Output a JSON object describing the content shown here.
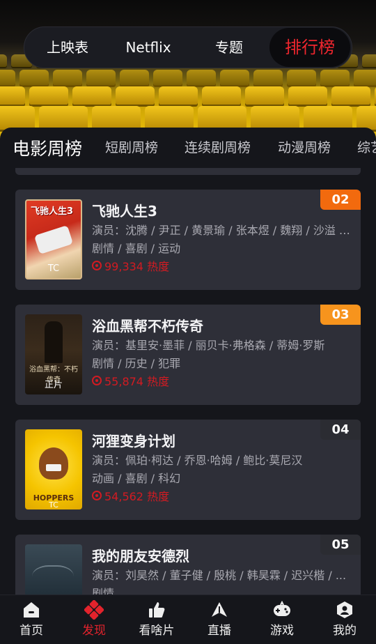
{
  "top_nav": {
    "tabs": [
      {
        "label": "上映表"
      },
      {
        "label": "Netflix"
      },
      {
        "label": "专题"
      },
      {
        "label": "排行榜",
        "active": true
      }
    ]
  },
  "category_tabs": [
    {
      "label": "电影周榜",
      "active": true
    },
    {
      "label": "短剧周榜"
    },
    {
      "label": "连续剧周榜"
    },
    {
      "label": "动漫周榜"
    },
    {
      "label": "综艺"
    }
  ],
  "ranking": [
    {
      "rank": "02",
      "rank_color": "#f26a0e",
      "title": "飞驰人生3",
      "actors": "演员：沈腾 / 尹正 / 黄景瑜 / 张本煜 / 魏翔 / 沙溢 / ...",
      "genres": "剧情 / 喜剧 / 运动",
      "heat": "99,334 热度",
      "poster_tag": "TC",
      "poster_title": "飞驰人生3"
    },
    {
      "rank": "03",
      "rank_color": "#f7941d",
      "title": "浴血黑帮不朽传奇",
      "actors": "演员：基里安·墨菲 / 丽贝卡·弗格森 / 蒂姆·罗斯",
      "genres": "剧情 / 历史 / 犯罪",
      "heat": "55,874 热度",
      "poster_tag": "正片",
      "poster_title": "浴血黑帮：不朽传奇"
    },
    {
      "rank": "04",
      "rank_color": "#2b2c32",
      "title": "河狸变身计划",
      "actors": "演员：佩珀·柯达 / 乔恩·哈姆 / 鲍比·莫尼汉",
      "genres": "动画 / 喜剧 / 科幻",
      "heat": "54,562 热度",
      "poster_tag": "TC",
      "poster_title": "HOPPERS"
    },
    {
      "rank": "05",
      "rank_color": "#2b2c32",
      "title": "我的朋友安德烈",
      "actors": "演员：刘昊然 / 董子健 / 殷桃 / 韩昊霖 / 迟兴楷 / ...",
      "genres": "剧情",
      "heat": "",
      "poster_tag": "",
      "poster_title": ""
    }
  ],
  "bottom_nav": [
    {
      "label": "首页",
      "icon": "home-icon"
    },
    {
      "label": "发现",
      "icon": "discover-icon",
      "active": true
    },
    {
      "label": "看啥片",
      "icon": "thumbs-up-icon"
    },
    {
      "label": "直播",
      "icon": "live-icon"
    },
    {
      "label": "游戏",
      "icon": "gamepad-icon"
    },
    {
      "label": "我的",
      "icon": "profile-icon"
    }
  ],
  "colors": {
    "accent": "#e3232c",
    "panel": "#15161b",
    "card": "#2e2f38"
  }
}
